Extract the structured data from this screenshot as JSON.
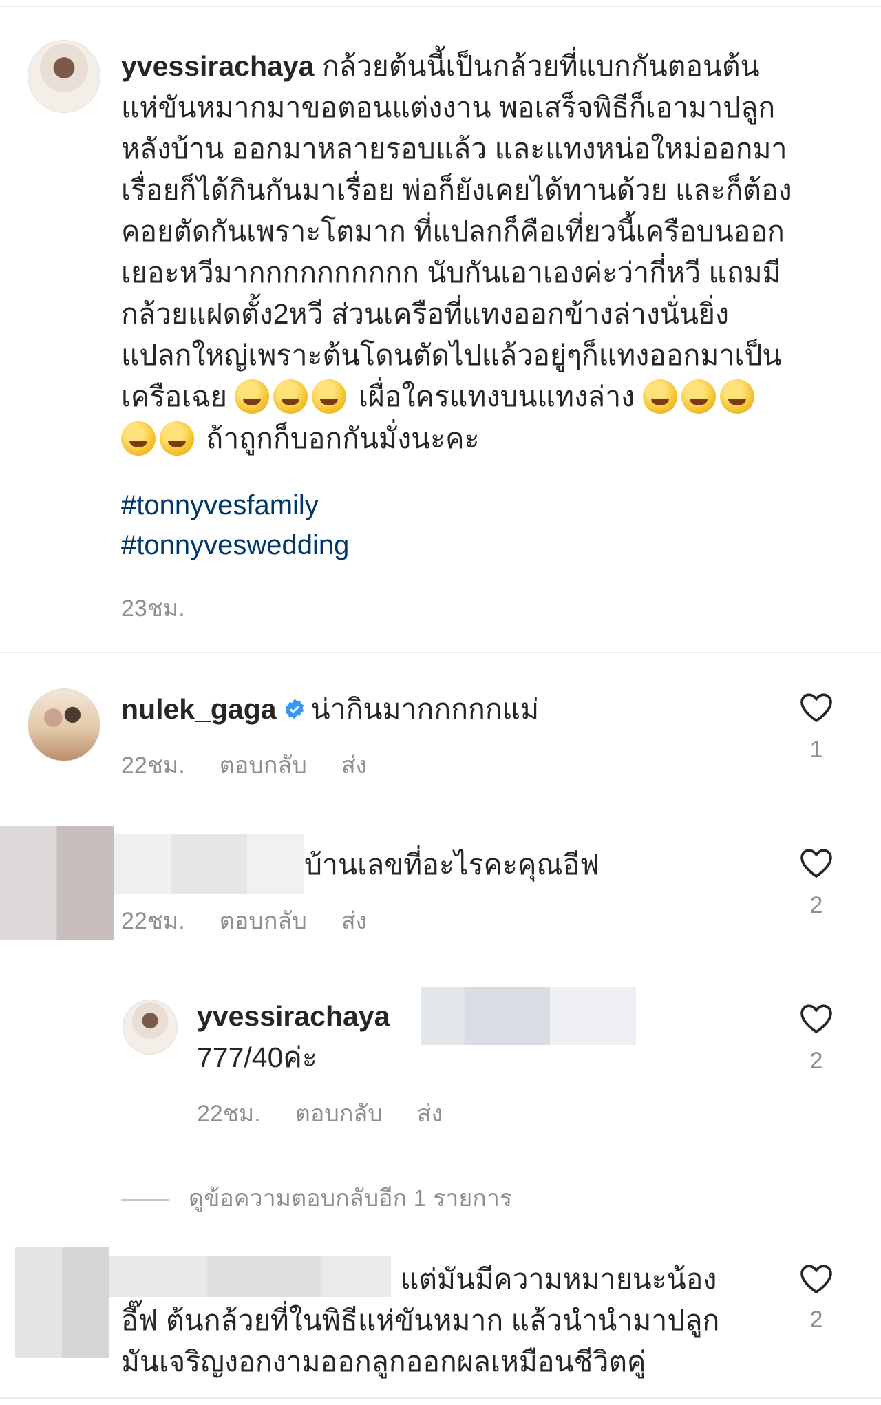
{
  "post": {
    "username": "yvessirachaya",
    "caption_lines": [
      "กล้วยต้นนี้เป็นกล้วยที่แบกกันตอนต้น",
      "แห่ขันหมากมาขอตอนแต่งงาน พอเสร็จพิธีก็เอามาปลูก",
      "หลังบ้าน ออกมาหลายรอบแล้ว และแทงหน่อใหม่ออกมา",
      "เรื่อยก็ได้กินกันมาเรื่อย พ่อก็ยังเคยได้ทานด้วย และก็ต้อง",
      "คอยตัดกันเพราะโตมาก ที่แปลกก็คือเที่ยวนี้เครือบนออก",
      "เยอะหวีมากกกกกกกกกก นับกันเอาเองค่ะว่ากี่หวี แถมมี",
      "กล้วยแฝดตั้ง2หวี ส่วนเครือที่แทงออกข้างล่างนั่นยิ่ง",
      "แปลกใหญ่เพราะต้นโดนตัดไปแล้วอยู่ๆก็แทงออกมาเป็น"
    ],
    "caption_line9_a": "เครือเฉย",
    "caption_line9_b": "เผื่อใครแทงบนแทงล่าง",
    "caption_line10": "ถ้าถูกก็บอกกันมั่งนะคะ",
    "emoji_name": "rolling-on-floor-laughing-emoji",
    "hashtags": [
      "#tonnyvesfamily",
      "#tonnyveswedding"
    ],
    "time": "23ชม."
  },
  "comments": [
    {
      "username": "nulek_gaga",
      "text": "น่ากินมากกกกกแม่",
      "time": "22ชม.",
      "reply": "ตอบกลับ",
      "send": "ส่ง",
      "likes": "1"
    },
    {
      "text": "บ้านเลขที่อะไรคะคุณอีฟ",
      "time": "22ชม.",
      "reply": "ตอบกลับ",
      "send": "ส่ง",
      "likes": "2"
    },
    {
      "username": "yvessirachaya",
      "text": "777/40ค่ะ",
      "time": "22ชม.",
      "reply": "ตอบกลับ",
      "send": "ส่ง",
      "likes": "2"
    },
    {
      "text_lines": [
        "แต่มันมีความหมายนะน้อง",
        "อี๊ฟ ต้นกล้วยที่ในพิธีแห่ขันหมาก แล้วนำนำมาปลูก",
        "มันเจริญงอกงามออกลูกออกผลเหมือนชีวิตคู่"
      ],
      "likes": "2"
    }
  ],
  "view_more_replies": "ดูข้อความตอบกลับอีก 1 รายการ",
  "colors": {
    "hashtag": "#00376b",
    "verified": "#3897f0",
    "meta": "#8e8e8e"
  }
}
